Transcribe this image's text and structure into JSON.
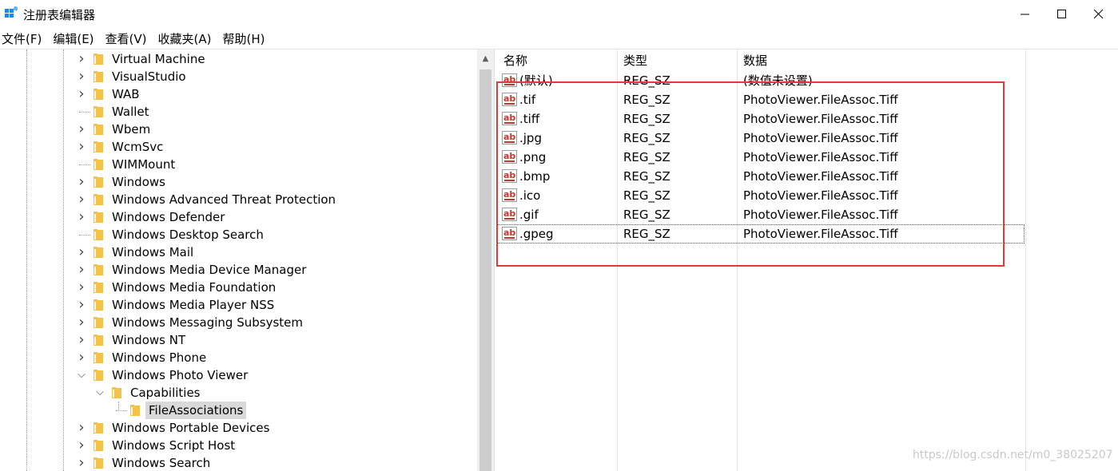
{
  "window": {
    "title": "注册表编辑器"
  },
  "menu": [
    "文件(F)",
    "编辑(E)",
    "查看(V)",
    "收藏夹(A)",
    "帮助(H)"
  ],
  "tree": [
    {
      "label": "Virtual Machine",
      "expander": "collapsed",
      "level": 0
    },
    {
      "label": "VisualStudio",
      "expander": "collapsed",
      "level": 0
    },
    {
      "label": "WAB",
      "expander": "collapsed",
      "level": 0
    },
    {
      "label": "Wallet",
      "expander": "none",
      "level": 0
    },
    {
      "label": "Wbem",
      "expander": "collapsed",
      "level": 0
    },
    {
      "label": "WcmSvc",
      "expander": "collapsed",
      "level": 0
    },
    {
      "label": "WIMMount",
      "expander": "none",
      "level": 0
    },
    {
      "label": "Windows",
      "expander": "collapsed",
      "level": 0
    },
    {
      "label": "Windows Advanced Threat Protection",
      "expander": "collapsed",
      "level": 0
    },
    {
      "label": "Windows Defender",
      "expander": "collapsed",
      "level": 0
    },
    {
      "label": "Windows Desktop Search",
      "expander": "none",
      "level": 0
    },
    {
      "label": "Windows Mail",
      "expander": "collapsed",
      "level": 0
    },
    {
      "label": "Windows Media Device Manager",
      "expander": "collapsed",
      "level": 0
    },
    {
      "label": "Windows Media Foundation",
      "expander": "collapsed",
      "level": 0
    },
    {
      "label": "Windows Media Player NSS",
      "expander": "collapsed",
      "level": 0
    },
    {
      "label": "Windows Messaging Subsystem",
      "expander": "collapsed",
      "level": 0
    },
    {
      "label": "Windows NT",
      "expander": "collapsed",
      "level": 0
    },
    {
      "label": "Windows Phone",
      "expander": "collapsed",
      "level": 0
    },
    {
      "label": "Windows Photo Viewer",
      "expander": "expanded",
      "level": 0
    },
    {
      "label": "Capabilities",
      "expander": "expanded",
      "level": 1
    },
    {
      "label": "FileAssociations",
      "expander": "none",
      "level": 2,
      "selected": true
    },
    {
      "label": "Windows Portable Devices",
      "expander": "collapsed",
      "level": 0
    },
    {
      "label": "Windows Script Host",
      "expander": "collapsed",
      "level": 0
    },
    {
      "label": "Windows Search",
      "expander": "collapsed",
      "level": 0
    }
  ],
  "list": {
    "columns": [
      "名称",
      "类型",
      "数据"
    ],
    "rows": [
      {
        "name": "(默认)",
        "type": "REG_SZ",
        "data": "(数值未设置)"
      },
      {
        "name": ".tif",
        "type": "REG_SZ",
        "data": "PhotoViewer.FileAssoc.Tiff"
      },
      {
        "name": ".tiff",
        "type": "REG_SZ",
        "data": "PhotoViewer.FileAssoc.Tiff"
      },
      {
        "name": ".jpg",
        "type": "REG_SZ",
        "data": "PhotoViewer.FileAssoc.Tiff"
      },
      {
        "name": ".png",
        "type": "REG_SZ",
        "data": "PhotoViewer.FileAssoc.Tiff"
      },
      {
        "name": ".bmp",
        "type": "REG_SZ",
        "data": "PhotoViewer.FileAssoc.Tiff"
      },
      {
        "name": ".ico",
        "type": "REG_SZ",
        "data": "PhotoViewer.FileAssoc.Tiff"
      },
      {
        "name": ".gif",
        "type": "REG_SZ",
        "data": "PhotoViewer.FileAssoc.Tiff"
      },
      {
        "name": ".gpeg",
        "type": "REG_SZ",
        "data": "PhotoViewer.FileAssoc.Tiff"
      }
    ]
  },
  "watermark": "https://blog.csdn.net/m0_38025207",
  "colors": {
    "highlight_box": "#e53935",
    "folder": "#f3c24a",
    "selected_bg": "#d9d9d9"
  }
}
